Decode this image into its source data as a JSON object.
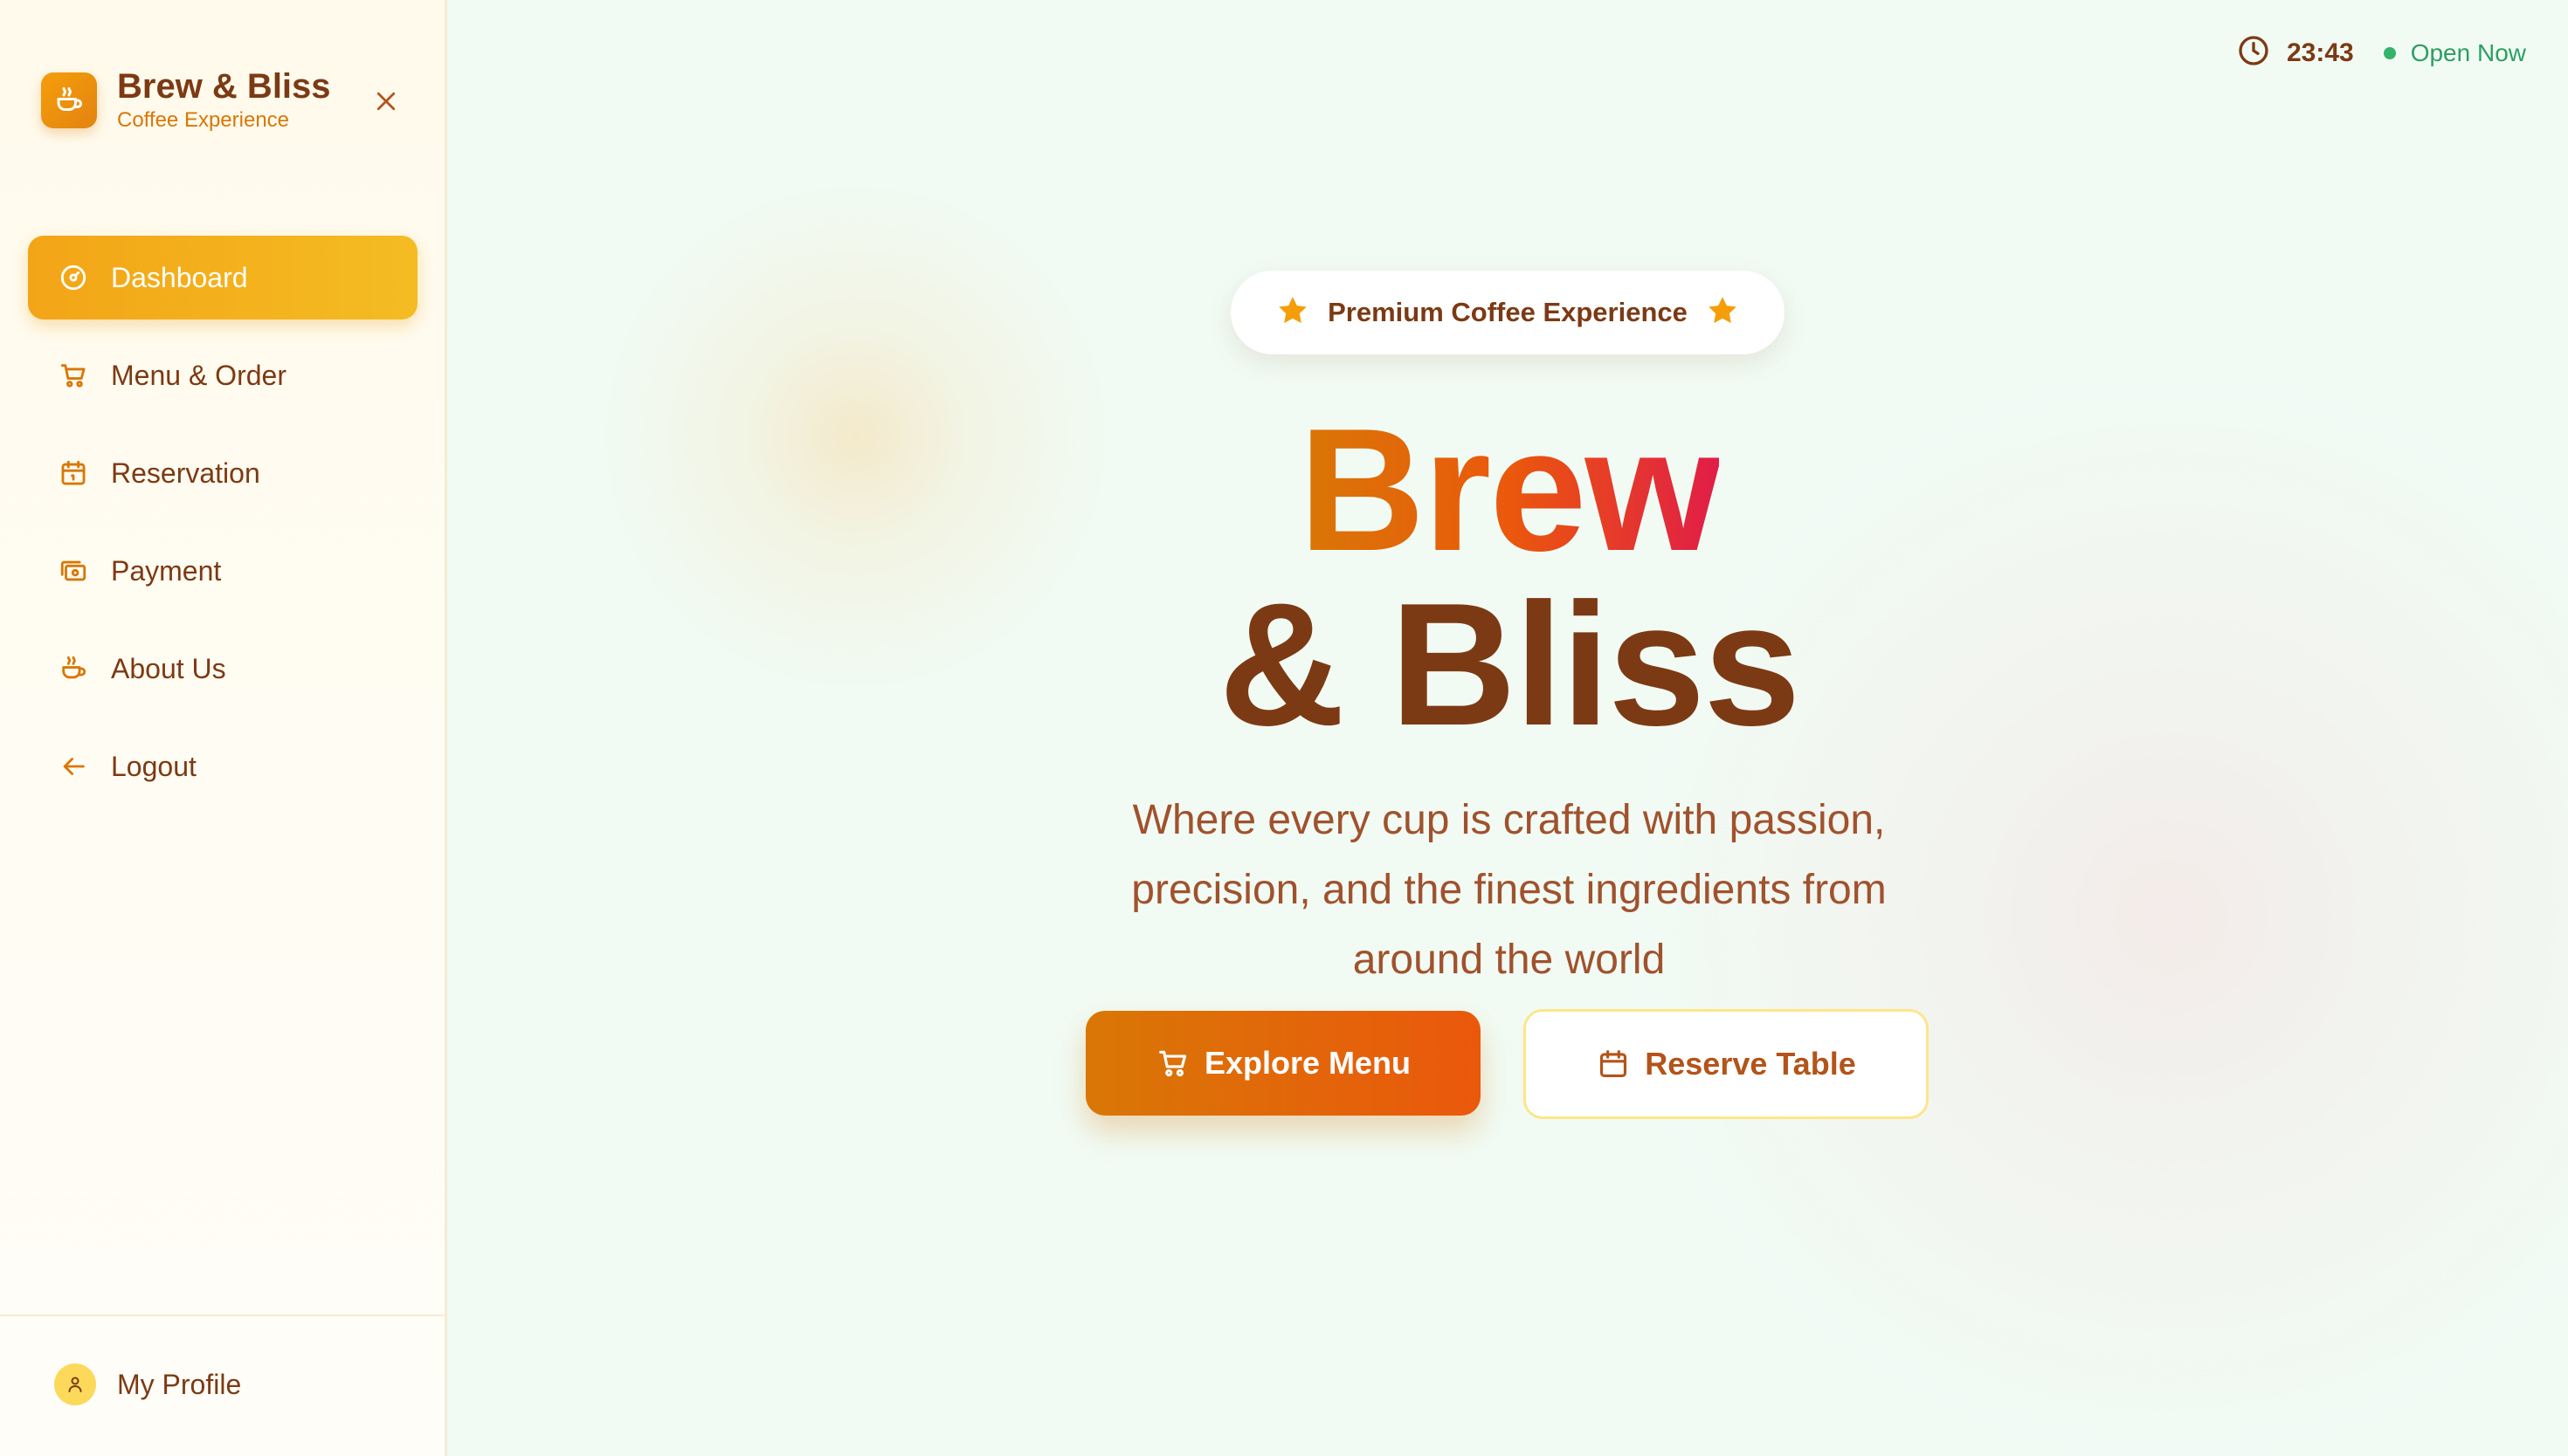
{
  "brand": {
    "title": "Brew & Bliss",
    "subtitle": "Coffee Experience",
    "logo_icon": "coffee-cup-icon"
  },
  "sidebar": {
    "close_icon": "close-icon",
    "items": [
      {
        "label": "Dashboard",
        "icon": "dashboard-icon",
        "active": true
      },
      {
        "label": "Menu & Order",
        "icon": "cart-icon",
        "active": false
      },
      {
        "label": "Reservation",
        "icon": "calendar-icon",
        "active": false
      },
      {
        "label": "Payment",
        "icon": "payment-icon",
        "active": false
      },
      {
        "label": "About Us",
        "icon": "coffee-cup-icon",
        "active": false
      },
      {
        "label": "Logout",
        "icon": "arrow-left-icon",
        "active": false
      }
    ],
    "profile": {
      "label": "My Profile",
      "icon": "user-icon"
    }
  },
  "topbar": {
    "time": "23:43",
    "status": "Open Now"
  },
  "hero": {
    "badge": "Premium Coffee Experience",
    "title_line1": "Brew",
    "title_line2": "& Bliss",
    "subtitle": "Where every cup is crafted with passion, precision, and the finest ingredients from around the world",
    "primary_button": "Explore Menu",
    "secondary_button": "Reserve Table"
  },
  "colors": {
    "brand_brown": "#7c3a14",
    "accent_orange": "#d97706",
    "accent_gold": "#f4bc22",
    "status_green": "#34b36a",
    "background": "#f1fbf4"
  }
}
